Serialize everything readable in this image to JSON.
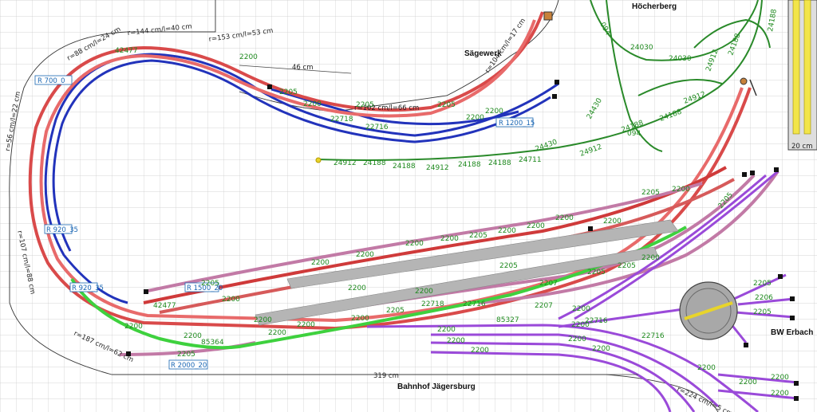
{
  "places": {
    "saegewerk": "Sägewerk",
    "hoecherberg": "Höcherberg",
    "bw_erbach": "BW Erbach",
    "bahnhof": "Bahnhof Jägersburg"
  },
  "dimensions": {
    "top_width": "46 cm",
    "bottom_width": "319 cm",
    "scale_box": "20 cm",
    "r_top_a": "r=153 cm/l=53 cm",
    "r_top_b": "r=144 cm/l=40 cm",
    "r_top_c": "r=102 cm/l=66 cm",
    "r_top_d": "r=104 cm/l=17 cm",
    "r_left_a": "r=88 cm/l=24 cm",
    "r_left_b": "r=107 cm/l=88 cm",
    "r_left_c": "r=56 cm/l=22 cm",
    "r_bottom_a": "r=187 cm/l=62 cm",
    "r_bottom_b": "r=224 cm/l=5 cm"
  },
  "radius_labels": {
    "r700": "R 700_0",
    "r1200": "R 1200_15",
    "r920a": "R 920_35",
    "r920b": "R 920_35",
    "r1500": "R 1500_20",
    "r2000": "R 2000_20"
  },
  "track_labels": {
    "green": [
      "24912",
      "24188",
      "24188",
      "24912",
      "24188",
      "24188",
      "24711",
      "24430",
      "24912",
      "24188",
      "094",
      "24912",
      "24188",
      "24030",
      "24030",
      "24430",
      "24188",
      "094",
      "24912",
      "24188"
    ],
    "main": [
      "2200",
      "2205",
      "2205",
      "2200",
      "2205",
      "2200",
      "2200",
      "2200",
      "2200",
      "2200",
      "2200",
      "2205",
      "2200",
      "2200",
      "2200",
      "2200",
      "2205",
      "2200",
      "2200",
      "2200",
      "2205",
      "2207",
      "2205",
      "2205",
      "2200",
      "2205",
      "2200",
      "2200",
      "2207",
      "2200",
      "2205",
      "2200",
      "2205",
      "2200",
      "2200",
      "22718",
      "22716",
      "22718",
      "22716",
      "42477",
      "42477",
      "85327",
      "85364",
      "2200",
      "2200"
    ],
    "fan": [
      "2200",
      "2200",
      "2200",
      "2200",
      "2200",
      "2205",
      "2206",
      "2205",
      "2205",
      "2200",
      "2200",
      "2200",
      "22716",
      "2200",
      "2200",
      "22716"
    ]
  }
}
